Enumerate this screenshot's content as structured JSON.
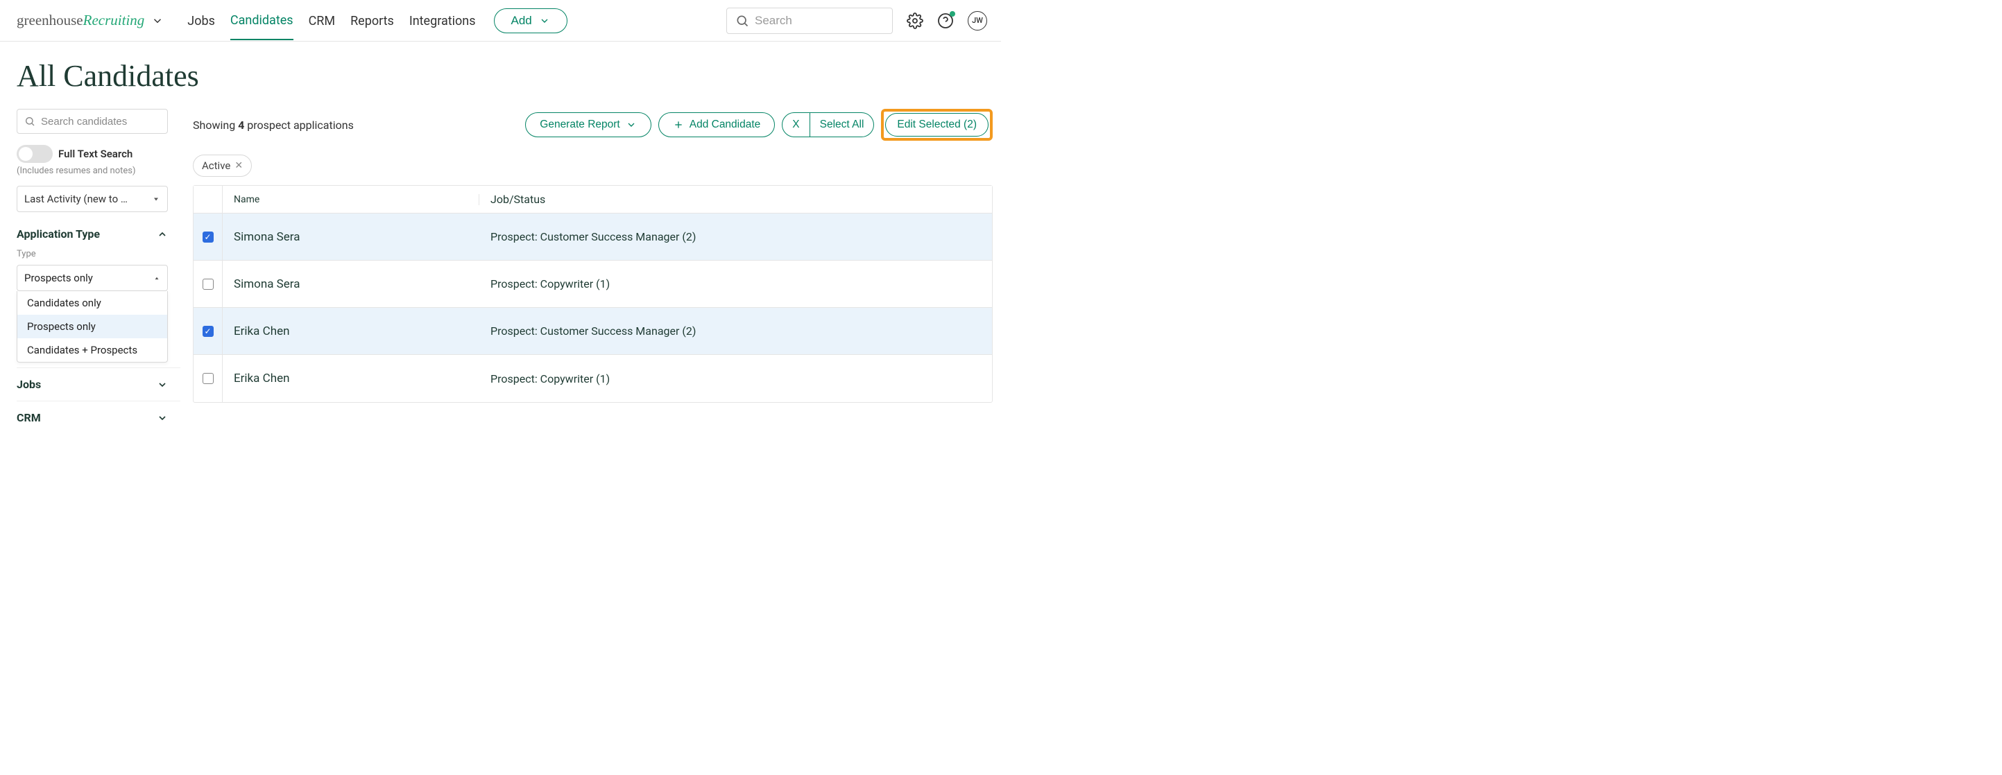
{
  "logo": {
    "part1": "greenhouse",
    "part2": " Recruiting"
  },
  "nav": {
    "jobs": "Jobs",
    "candidates": "Candidates",
    "crm": "CRM",
    "reports": "Reports",
    "integrations": "Integrations"
  },
  "top": {
    "add": "Add",
    "search_placeholder": "Search",
    "avatar_initials": "JW"
  },
  "title": "All Candidates",
  "sidebar": {
    "search_placeholder": "Search candidates",
    "fts_label": "Full Text Search",
    "fts_sub": "(Includes resumes and notes)",
    "sort_value": "Last Activity (new to …",
    "app_type_head": "Application Type",
    "type_label": "Type",
    "type_value": "Prospects only",
    "type_options": [
      "Candidates only",
      "Prospects only",
      "Candidates + Prospects"
    ],
    "jobs_head": "Jobs",
    "crm_head": "CRM"
  },
  "toolbar": {
    "showing_pre": "Showing ",
    "showing_count": "4",
    "showing_post": " prospect applications",
    "generate_report": "Generate Report",
    "add_candidate": "Add Candidate",
    "bulk_x": "X",
    "select_all": "Select All",
    "edit_selected": "Edit Selected (2)"
  },
  "chip": {
    "active": "Active"
  },
  "table": {
    "head_name": "Name",
    "head_status": "Job/Status",
    "rows": [
      {
        "checked": true,
        "name": "Simona Sera",
        "status": "Prospect: Customer Success Manager (2)"
      },
      {
        "checked": false,
        "name": "Simona Sera",
        "status": "Prospect: Copywriter (1)"
      },
      {
        "checked": true,
        "name": "Erika Chen",
        "status": "Prospect: Customer Success Manager (2)"
      },
      {
        "checked": false,
        "name": "Erika Chen",
        "status": "Prospect: Copywriter (1)"
      }
    ]
  }
}
